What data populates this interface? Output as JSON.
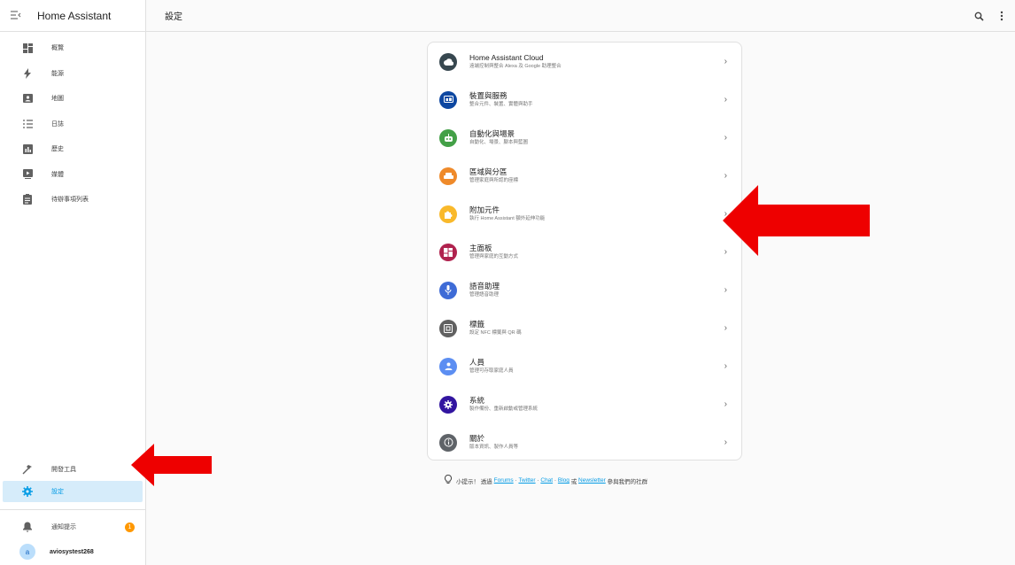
{
  "app": {
    "title": "Home Assistant"
  },
  "header": {
    "page_title": "設定"
  },
  "sidebar": {
    "items": [
      {
        "label": "概覽",
        "icon": "dashboard-icon"
      },
      {
        "label": "能源",
        "icon": "lightning-icon"
      },
      {
        "label": "地圖",
        "icon": "map-icon"
      },
      {
        "label": "日誌",
        "icon": "logbook-icon"
      },
      {
        "label": "歷史",
        "icon": "history-chart-icon"
      },
      {
        "label": "媒體",
        "icon": "media-play-icon"
      },
      {
        "label": "待辦事項列表",
        "icon": "clipboard-list-icon"
      }
    ],
    "dev_tools": {
      "label": "開發工具",
      "icon": "hammer-icon"
    },
    "settings": {
      "label": "設定",
      "icon": "gear-icon"
    },
    "notifications": {
      "label": "通知提示",
      "icon": "bell-icon",
      "badge": "1"
    },
    "user": {
      "avatar_letter": "a",
      "name": "aviosystest268"
    }
  },
  "settings_list": [
    {
      "title": "Home Assistant Cloud",
      "subtitle": "遠端控制與整合 Alexa 及 Google 助理整合",
      "icon": "cloud-icon",
      "color": "#37474f"
    },
    {
      "title": "裝置與服務",
      "subtitle": "整合元件、裝置、實體與助手",
      "icon": "devices-icon",
      "color": "#0d47a1"
    },
    {
      "title": "自動化與場景",
      "subtitle": "自動化、場景、腳本與藍圖",
      "icon": "robot-icon",
      "color": "#43a047"
    },
    {
      "title": "區域與分區",
      "subtitle": "管理家庭與所認的座標",
      "icon": "sofa-icon",
      "color": "#ef8a2a"
    },
    {
      "title": "附加元件",
      "subtitle": "執行 Home Assistant 額外延伸功能",
      "icon": "puzzle-icon",
      "color": "#f9b92b"
    },
    {
      "title": "主面板",
      "subtitle": "管理與家庭的互動方式",
      "icon": "dashboard-icon",
      "color": "#b0224e"
    },
    {
      "title": "語音助理",
      "subtitle": "管理語音助理",
      "icon": "microphone-icon",
      "color": "#3e6bd6"
    },
    {
      "title": "標籤",
      "subtitle": "設定 NFC 標籤與 QR 碼",
      "icon": "tag-icon",
      "color": "#616161"
    },
    {
      "title": "人員",
      "subtitle": "管理可存取家庭人員",
      "icon": "person-icon",
      "color": "#5c8ef2"
    },
    {
      "title": "系統",
      "subtitle": "製作備份、重新啟動或管理系統",
      "icon": "gear-icon",
      "color": "#3215a0"
    },
    {
      "title": "關於",
      "subtitle": "版本資訊、製作人員等",
      "icon": "info-icon",
      "color": "#5f6368"
    }
  ],
  "tip": {
    "prefix": "小提示！ 透過",
    "links": [
      "Forums",
      "Twitter",
      "Chat",
      "Blog"
    ],
    "or": "或",
    "newsletter": "Newsletter",
    "suffix": "參與我們的社群"
  },
  "colors": {
    "accent": "#039be5",
    "arrow": "#ee0000",
    "selected_bg": "#d6ecfa"
  }
}
